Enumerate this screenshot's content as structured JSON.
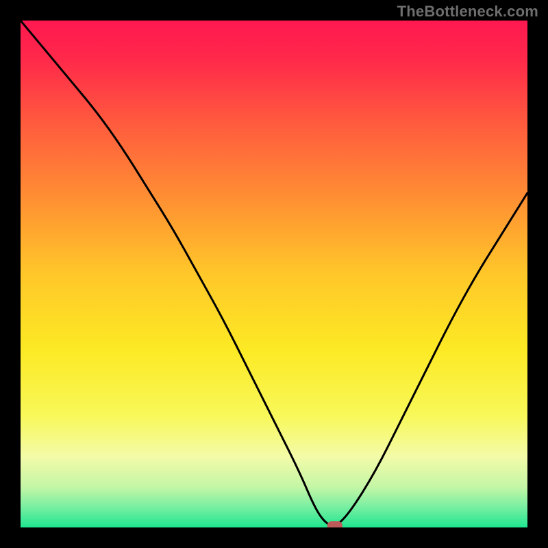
{
  "watermark": "TheBottleneck.com",
  "gradient": {
    "stops": [
      {
        "offset": 0.0,
        "color": "#ff1850"
      },
      {
        "offset": 0.08,
        "color": "#ff2a4a"
      },
      {
        "offset": 0.2,
        "color": "#ff5a3e"
      },
      {
        "offset": 0.35,
        "color": "#ff8f33"
      },
      {
        "offset": 0.5,
        "color": "#ffc729"
      },
      {
        "offset": 0.65,
        "color": "#fcea24"
      },
      {
        "offset": 0.78,
        "color": "#f8f85a"
      },
      {
        "offset": 0.86,
        "color": "#f3fba8"
      },
      {
        "offset": 0.92,
        "color": "#c4f6a6"
      },
      {
        "offset": 0.96,
        "color": "#78efa2"
      },
      {
        "offset": 1.0,
        "color": "#1ee58f"
      }
    ]
  },
  "chart_data": {
    "type": "line",
    "title": "",
    "xlabel": "",
    "ylabel": "",
    "xlim": [
      0,
      100
    ],
    "ylim": [
      0,
      100
    ],
    "series": [
      {
        "name": "bottleneck-curve",
        "x": [
          0,
          5,
          10,
          15,
          20,
          25,
          30,
          35,
          40,
          45,
          50,
          55,
          58,
          60,
          62,
          65,
          70,
          75,
          80,
          85,
          90,
          95,
          100
        ],
        "values": [
          100,
          94,
          88,
          82,
          75,
          67,
          59,
          50,
          41,
          31,
          21,
          11,
          4,
          1,
          0,
          3,
          11,
          21,
          31,
          41,
          50,
          58,
          66
        ]
      }
    ],
    "marker": {
      "x": 62,
      "y": 0,
      "name": "optimal-point"
    }
  }
}
